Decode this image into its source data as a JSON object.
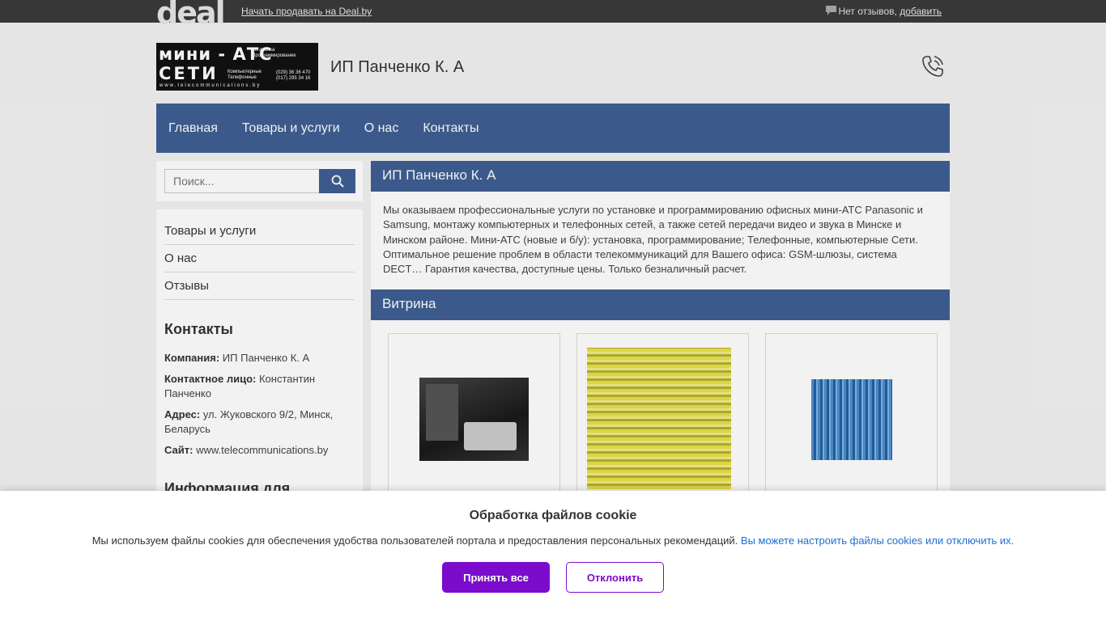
{
  "topbar": {
    "logo": "deal",
    "sell_link": "Начать продавать на Deal.by",
    "reviews_text": "Нет отзывов, ",
    "reviews_link": "добавить"
  },
  "header": {
    "logo": {
      "line1": "мини - АТС",
      "line2": "СЕТИ",
      "small1a": "Установка",
      "small1b": "Программирование",
      "small2a": "Компьютерные",
      "small2b": "Телефонные",
      "phone1": "(029) 36 36 470",
      "phone2": "(017) 295 34 16",
      "site": "www.telecommunications.by"
    },
    "company_name": "ИП Панченко К. А"
  },
  "nav": {
    "items": [
      "Главная",
      "Товары и услуги",
      "О нас",
      "Контакты"
    ]
  },
  "sidebar": {
    "search_placeholder": "Поиск...",
    "menu": [
      "Товары и услуги",
      "О нас",
      "Отзывы"
    ],
    "contacts_title": "Контакты",
    "company_label": "Компания:",
    "company_value": "ИП Панченко К. А",
    "person_label": "Контактное лицо:",
    "person_value": "Константин Панченко",
    "address_label": "Адрес:",
    "address_value": "ул. Жуковского 9/2, Минск, Беларусь",
    "site_label": "Сайт:",
    "site_value": "www.telecommunications.by",
    "info_title": "Информация для"
  },
  "main": {
    "about_title": "ИП Панченко К. А",
    "about_text": "Мы оказываем профессиональные услуги по установке и программированию офисных мини-АТС Panasonic и Samsung, монтажу компьютерных и телефонных сетей, а также сетей передачи видео и звука в Минске и Минском районе. Мини-АТС (новые и б/у): установка, программирование; Телефонные, компьютерные Сети. Оптимальное решение проблем в области телекоммуникаций для Вашего офиса: GSM-шлюзы, система DECT… Гарантия качества, доступные цены. Только безналичный расчет.",
    "showcase_title": "Витрина"
  },
  "cookie": {
    "title": "Обработка файлов cookie",
    "text": "Мы используем файлы cookies для обеспечения удобства пользователей портала и предоставления персональных рекомендаций.",
    "link": "Вы можете настроить файлы cookies или отключить их.",
    "accept": "Принять все",
    "decline": "Отклонить"
  },
  "colors": {
    "nav": "#3f5f93",
    "topbar": "#3a3a3a",
    "accept": "#7b0ccc",
    "link": "#1a6fd4"
  }
}
